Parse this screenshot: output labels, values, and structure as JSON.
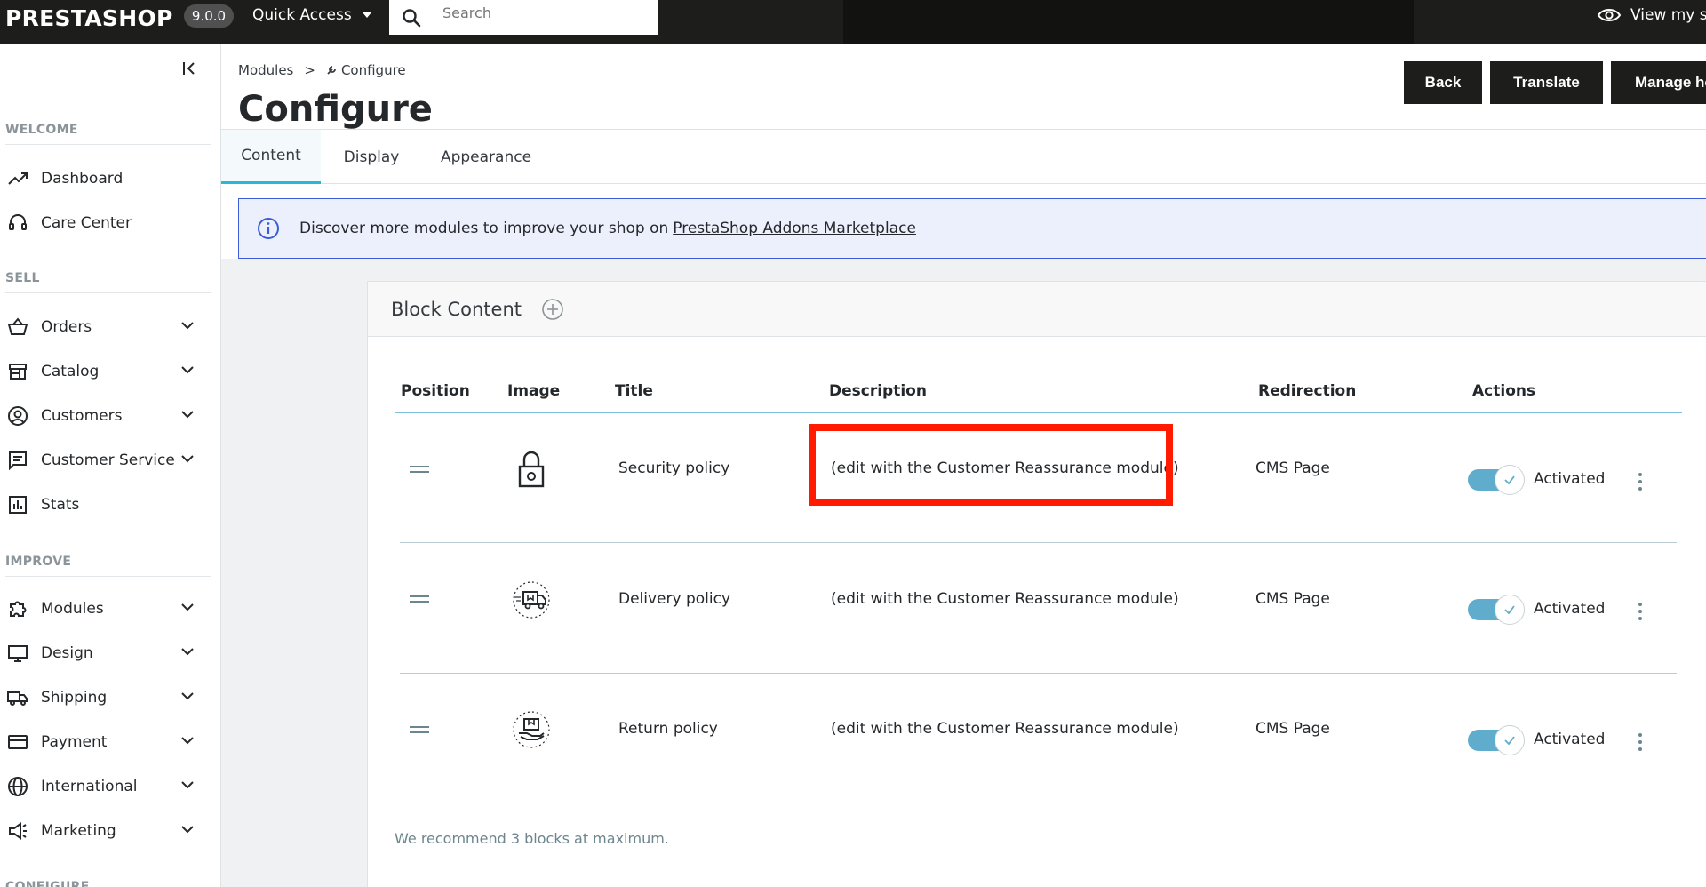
{
  "topbar": {
    "logo": "PRESTASHOP",
    "version": "9.0.0",
    "quick_access": "Quick Access",
    "search_placeholder": "Search",
    "view_store": "View my store"
  },
  "sidebar": {
    "sections": {
      "welcome": "WELCOME",
      "sell": "SELL",
      "improve": "IMPROVE",
      "configure": "CONFIGURE"
    },
    "items": [
      {
        "label": "Dashboard",
        "icon": "trending-up-icon"
      },
      {
        "label": "Care Center",
        "icon": "headset-icon"
      },
      {
        "label": "Orders",
        "icon": "basket-icon"
      },
      {
        "label": "Catalog",
        "icon": "store-icon"
      },
      {
        "label": "Customers",
        "icon": "account-circle-icon"
      },
      {
        "label": "Customer Service",
        "icon": "chat-icon"
      },
      {
        "label": "Stats",
        "icon": "bar-chart-icon"
      },
      {
        "label": "Modules",
        "icon": "puzzle-icon"
      },
      {
        "label": "Design",
        "icon": "monitor-icon"
      },
      {
        "label": "Shipping",
        "icon": "truck-icon"
      },
      {
        "label": "Payment",
        "icon": "credit-card-icon"
      },
      {
        "label": "International",
        "icon": "globe-icon"
      },
      {
        "label": "Marketing",
        "icon": "megaphone-icon"
      }
    ]
  },
  "header": {
    "breadcrumb": {
      "parent": "Modules",
      "separator": ">",
      "current": "Configure"
    },
    "title": "Configure",
    "buttons": {
      "back": "Back",
      "translate": "Translate",
      "manage_hooks": "Manage hooks"
    }
  },
  "tabs": [
    "Content",
    "Display",
    "Appearance"
  ],
  "alert": {
    "text": "Discover more modules to improve your shop on",
    "link": "PrestaShop Addons Marketplace"
  },
  "card": {
    "title": "Block Content",
    "columns": [
      "Position",
      "Image",
      "Title",
      "Description",
      "Redirection",
      "Actions"
    ],
    "rows": [
      {
        "title": "Security policy",
        "description": "(edit with the Customer Reassurance module)",
        "redirection": "CMS Page",
        "status": "Activated",
        "image_icon": "padlock-icon"
      },
      {
        "title": "Delivery policy",
        "description": "(edit with the Customer Reassurance module)",
        "redirection": "CMS Page",
        "status": "Activated",
        "image_icon": "delivery-truck-icon"
      },
      {
        "title": "Return policy",
        "description": "(edit with the Customer Reassurance module)",
        "redirection": "CMS Page",
        "status": "Activated",
        "image_icon": "return-box-icon"
      }
    ],
    "footer_note": "We recommend 3 blocks at maximum."
  },
  "colors": {
    "topbar": "#1d1d1b",
    "accent": "#25b9d7",
    "toggle_on": "#5faccd",
    "highlight": "#ff1a00",
    "alert_border": "#3b5cd6"
  }
}
